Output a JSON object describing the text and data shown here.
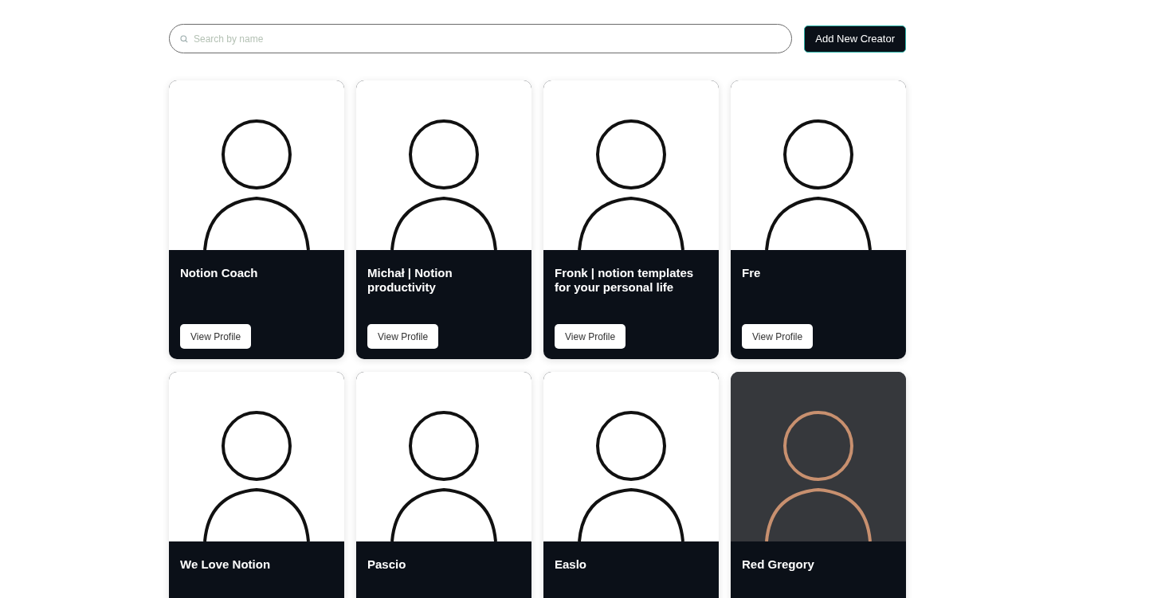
{
  "search": {
    "placeholder": "Search by name"
  },
  "add_button": "Add New Creator",
  "creators": [
    {
      "kind": "illustration",
      "name": "Notion Coach",
      "button": "View Profile"
    },
    {
      "kind": "illustration",
      "name": "Michał | Notion productivity",
      "button": "View Profile"
    },
    {
      "kind": "illustration",
      "name": "Fronk | notion templates for your personal life",
      "button": "View Profile"
    },
    {
      "kind": "illustration",
      "name": "Fre",
      "button": "View Profile"
    },
    {
      "kind": "illustration",
      "name": "We Love Notion"
    },
    {
      "kind": "illustration",
      "name": "Pascio"
    },
    {
      "kind": "illustration",
      "name": "Easlo"
    },
    {
      "kind": "avatar3d",
      "name": "Red Gregory"
    }
  ]
}
